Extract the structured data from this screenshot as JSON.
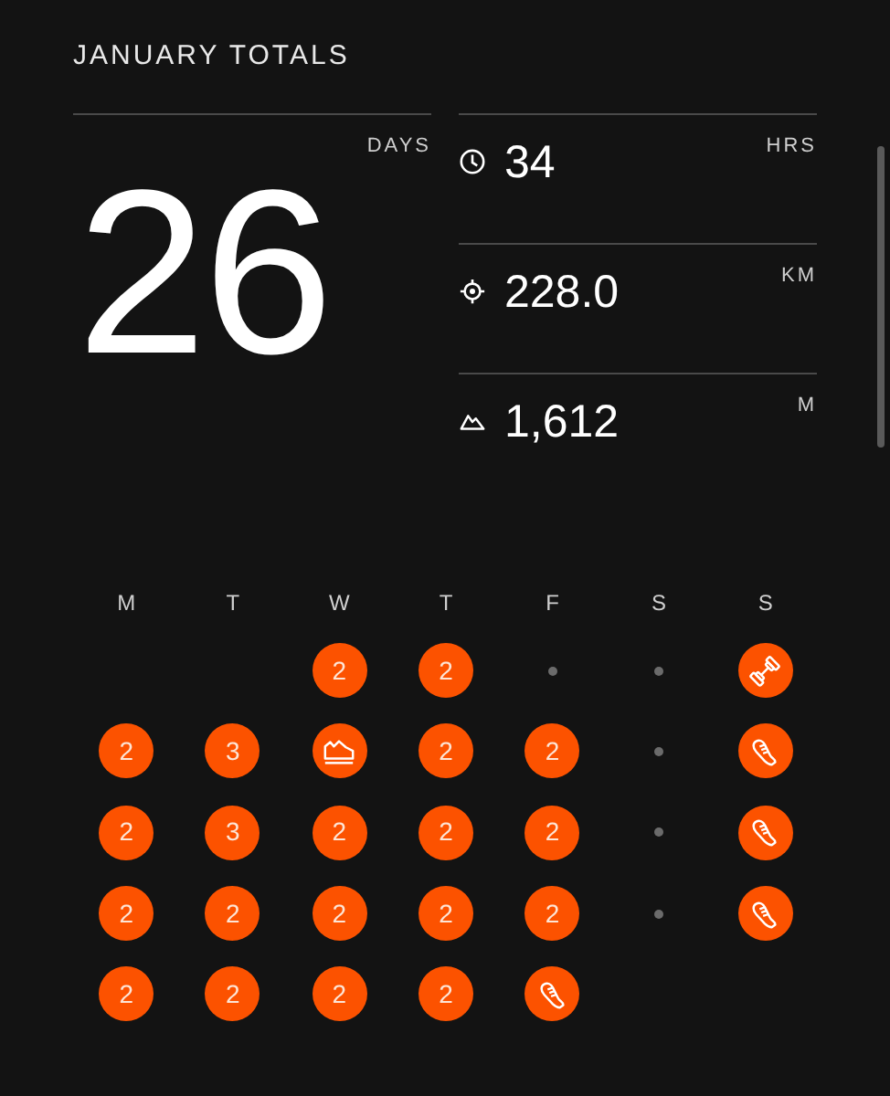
{
  "title": "JANUARY TOTALS",
  "days": {
    "value": "26",
    "unit": "DAYS"
  },
  "stats": [
    {
      "kind": "time",
      "value": "34",
      "unit": "HRS"
    },
    {
      "kind": "distance",
      "value": "228.0",
      "unit": "KM"
    },
    {
      "kind": "elevation",
      "value": "1,612",
      "unit": "M"
    }
  ],
  "weekdays": [
    "M",
    "T",
    "W",
    "T",
    "F",
    "S",
    "S"
  ],
  "weeks": [
    [
      {
        "kind": "empty"
      },
      {
        "kind": "empty"
      },
      {
        "kind": "count",
        "text": "2"
      },
      {
        "kind": "count",
        "text": "2"
      },
      {
        "kind": "rest"
      },
      {
        "kind": "rest"
      },
      {
        "kind": "dumbbell"
      }
    ],
    [
      {
        "kind": "count",
        "text": "2"
      },
      {
        "kind": "count",
        "text": "3"
      },
      {
        "kind": "sneaker"
      },
      {
        "kind": "count",
        "text": "2"
      },
      {
        "kind": "count",
        "text": "2"
      },
      {
        "kind": "rest"
      },
      {
        "kind": "running"
      }
    ],
    [
      {
        "kind": "count",
        "text": "2"
      },
      {
        "kind": "count",
        "text": "3"
      },
      {
        "kind": "count",
        "text": "2"
      },
      {
        "kind": "count",
        "text": "2"
      },
      {
        "kind": "count",
        "text": "2"
      },
      {
        "kind": "rest"
      },
      {
        "kind": "running"
      }
    ],
    [
      {
        "kind": "count",
        "text": "2"
      },
      {
        "kind": "count",
        "text": "2"
      },
      {
        "kind": "count",
        "text": "2"
      },
      {
        "kind": "count",
        "text": "2"
      },
      {
        "kind": "count",
        "text": "2"
      },
      {
        "kind": "rest"
      },
      {
        "kind": "running"
      }
    ],
    [
      {
        "kind": "count",
        "text": "2"
      },
      {
        "kind": "count",
        "text": "2"
      },
      {
        "kind": "count",
        "text": "2"
      },
      {
        "kind": "count",
        "text": "2"
      },
      {
        "kind": "running"
      },
      {
        "kind": "empty"
      },
      {
        "kind": "empty"
      }
    ]
  ]
}
